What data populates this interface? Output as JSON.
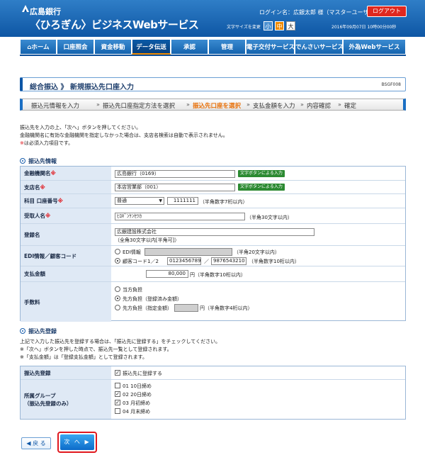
{
  "header": {
    "bank_name": "広島銀行",
    "service_name": "〈ひろぎん〉ビジネスWebサービス",
    "login_user": "ログイン名：広銀太郎 様（マスターユーザ）",
    "logout_label": "ログアウト",
    "fontsize_label": "文字サイズを変更",
    "fontsize_options": [
      "小",
      "中",
      "大"
    ],
    "datetime": "2016年09月07日 10時00分00秒"
  },
  "nav": {
    "tabs": [
      {
        "label": "ホーム"
      },
      {
        "label": "口座照会"
      },
      {
        "label": "資金移動"
      },
      {
        "label": "データ伝送"
      },
      {
        "label": "承認"
      },
      {
        "label": "管理"
      },
      {
        "label": "電子交付サービス"
      },
      {
        "label": "でんさいサービス"
      },
      {
        "label": "外為Webサービス"
      }
    ]
  },
  "page": {
    "title": "総合振込 》 新規振込先口座入力",
    "screen_id": "BSGF008"
  },
  "steps": [
    "振込元情報を入力",
    "振込先口座指定方法を選択",
    "振込先口座を選択",
    "支払金額を入力",
    "内容確認",
    "確定"
  ],
  "intro": {
    "line1": "振込先を入力の上、「次へ」ボタンを押してください。",
    "line2": "金融機関名に有効な金融機関を指定しなかった場合は、支店名検索は自動で表示されません。",
    "line3_mark": "※",
    "line3": "は必須入力項目です。"
  },
  "section1": {
    "title": "振込先情報",
    "bank": {
      "label": "金融機関名",
      "value": "広島銀行（0169）",
      "button": "文字ボタンによる入力"
    },
    "branch": {
      "label": "支店名",
      "value": "本店営業部（001）",
      "button": "文字ボタンによる入力"
    },
    "account": {
      "label": "科目 口座番号",
      "type": "普通",
      "number": "1111111",
      "hint": "（半角数字7桁以内）"
    },
    "recipient": {
      "label": "受取人名",
      "value": "ﾋﾛｷﾞﾝｹﾝｾﾂｶ",
      "hint": "（半角30文字以内）"
    },
    "register_name": {
      "label": "登録名",
      "value": "広銀建設株式会社",
      "hint": "（全角30文字以内[半角可]）"
    },
    "edi": {
      "label": "EDI情報／顧客コード",
      "opt1": "EDI情報",
      "opt1_hint": "（半角20文字以内）",
      "opt2": "顧客コード1／2",
      "code1": "0123456789",
      "slash": "／",
      "code2": "9876543210",
      "opt2_hint": "（半角数字10桁以内）"
    },
    "amount": {
      "label": "支払金額",
      "value": "80,000",
      "unit": "円（半角数字10桁以内）"
    },
    "fee": {
      "label": "手数料",
      "opt1": "当方負担",
      "opt2": "先方負担（登録済み金額）",
      "opt3": "先方負担（指定金額）",
      "unit": "円（半角数字4桁以内）"
    }
  },
  "section2": {
    "title": "振込先登録",
    "desc1": "上記で入力した振込先を登録する場合は、「振込先に登録する」をチェックしてください。",
    "desc2": "※「次へ」ボタンを押した時点で、振込先一覧として登録されます。",
    "desc3": "※「支払金額」は「登録支払金額」として登録されます。",
    "register": {
      "label": "振込先登録",
      "checkbox": "振込先に登録する"
    },
    "group": {
      "label1": "所属グループ",
      "label2": "（振込先登録のみ）",
      "items": [
        {
          "label": "01 10日締め",
          "checked": false
        },
        {
          "label": "02 20日締め",
          "checked": true
        },
        {
          "label": "03 月初締め",
          "checked": true
        },
        {
          "label": "04 月末締め",
          "checked": false
        }
      ]
    }
  },
  "buttons": {
    "back": "◀ 戻 る",
    "next": "次 へ ▶"
  },
  "colors": {
    "header_blue": "#0e56a4",
    "accent_orange": "#e8720c",
    "required_red": "#e0181e",
    "logout_red": "#e0281e"
  }
}
